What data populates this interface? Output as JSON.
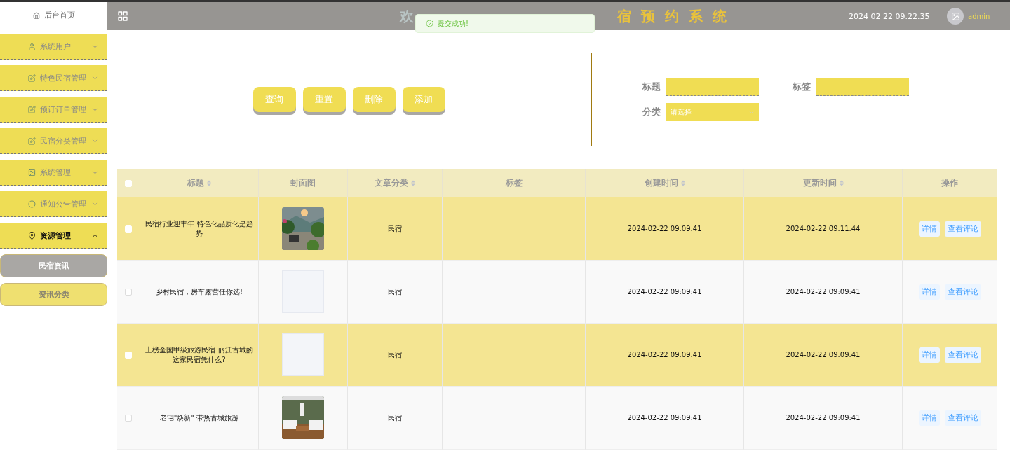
{
  "sidebar": {
    "home": {
      "label": "后台首页"
    },
    "items": [
      {
        "label": "系统用户",
        "expanded": false
      },
      {
        "label": "特色民宿管理",
        "expanded": false
      },
      {
        "label": "预订订单管理",
        "expanded": false
      },
      {
        "label": "民宿分类管理",
        "expanded": false
      },
      {
        "label": "系统管理",
        "expanded": false
      },
      {
        "label": "通知公告管理",
        "expanded": false
      },
      {
        "label": "资源管理",
        "expanded": true,
        "children": [
          {
            "label": "民宿资讯",
            "selected": true
          },
          {
            "label": "资讯分类",
            "selected": false
          }
        ]
      }
    ]
  },
  "header": {
    "title_start": "欢",
    "title_end": "宿预约系统",
    "datetime": "2024 02 22 09.22.35",
    "user": "admin"
  },
  "toast": {
    "message": "提交成功!"
  },
  "toolbar": {
    "buttons": [
      "查询",
      "重置",
      "删除",
      "添加"
    ]
  },
  "search": {
    "fields": [
      {
        "kind": "input",
        "label": "标题"
      },
      {
        "kind": "input",
        "label": "标签"
      },
      {
        "kind": "select",
        "label": "分类",
        "placeholder": "请选择"
      }
    ]
  },
  "table": {
    "all_checked": false,
    "columns": [
      {
        "label": "标题",
        "sortable": true
      },
      {
        "label": "封面图",
        "sortable": false
      },
      {
        "label": "文章分类",
        "sortable": true
      },
      {
        "label": "标签",
        "sortable": false
      },
      {
        "label": "创建时间",
        "sortable": true
      },
      {
        "label": "更新时间",
        "sortable": true
      },
      {
        "label": "操作",
        "sortable": false
      }
    ],
    "rows": [
      {
        "checked": false,
        "title": "民宿行业迎丰年 特色化品质化是趋势",
        "cover": {
          "kind": "picture"
        },
        "category": "民宿",
        "created": "2024-02-22 09.09.41",
        "updated": "2024-02-22 09.11.44",
        "actions": [
          "详情",
          "查看评论"
        ]
      },
      {
        "checked": false,
        "title": "乡村民宿，房车露营任你选!",
        "cover": {
          "kind": "empty"
        },
        "category": "民宿",
        "created": "2024-02-22 09:09:41",
        "updated": "2024-02-22 09:09:41",
        "actions": [
          "详情",
          "查看评论"
        ]
      },
      {
        "checked": false,
        "title": "上榜全国甲级旅游民宿 丽江古城的这家民宿凭什么?",
        "cover": {
          "kind": "empty"
        },
        "category": "民宿",
        "created": "2024-02-22 09.09.41",
        "updated": "2024-02-22 09.09.41",
        "actions": [
          "详情",
          "查看评论"
        ]
      },
      {
        "checked": false,
        "title": "老宅\"焕新\" 带热古城旅游",
        "cover": {
          "kind": "picture"
        },
        "category": "民宿",
        "created": "2024-02-22 09:09:41",
        "updated": "2024-02-22 09:09:41",
        "actions": [
          "详情",
          "查看评论"
        ]
      }
    ]
  }
}
